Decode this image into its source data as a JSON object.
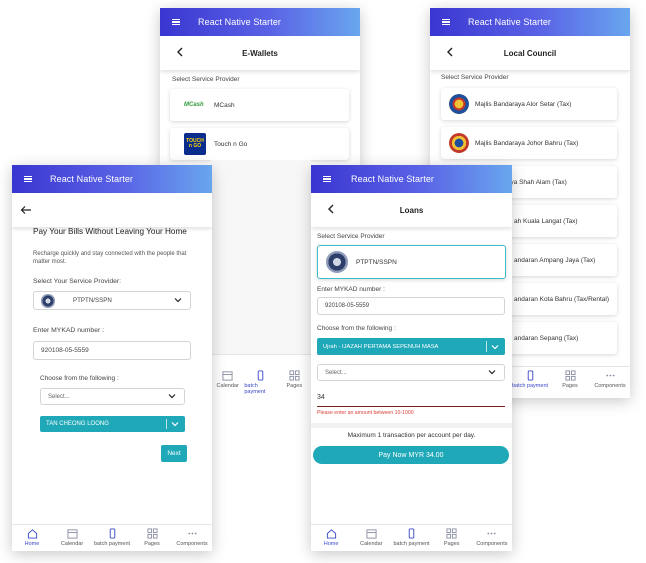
{
  "app": {
    "title": "React Native Starter"
  },
  "nav": [
    {
      "label": "Home",
      "icon": "home-icon"
    },
    {
      "label": "Calendar",
      "icon": "calendar-icon"
    },
    {
      "label": "batch payment",
      "icon": "phone-icon"
    },
    {
      "label": "Pages",
      "icon": "grid-icon"
    },
    {
      "label": "Components",
      "icon": "more-icon"
    }
  ],
  "ewallets": {
    "title": "E-Wallets",
    "section_label": "Select Service Provider",
    "providers": [
      {
        "name": "MCash",
        "logo_text": "MCash"
      },
      {
        "name": "Touch n Go",
        "logo_text": "TOUCH n GO"
      }
    ]
  },
  "local_council": {
    "title": "Local Council",
    "section_label": "Select Service Provider",
    "providers": [
      "Majlis Bandaraya Alor Setar (Tax)",
      "Majlis Bandaraya Johor Bahru (Tax)",
      "araya Shah Alam (Tax)",
      "ah Kuala Langat (Tax)",
      "andaran Ampang Jaya (Tax)",
      "andaran Kota Bahru (Tax/Rental)",
      "andaran Sepang (Tax)"
    ],
    "nav_visible": [
      "batch payment",
      "Pages",
      "Components"
    ]
  },
  "home": {
    "headline": "Pay Your Bills Without Leaving Your Home",
    "subtext": "Recharge quickly and stay connected with the people that matter most.",
    "provider_label": "Select Your Service Provider:",
    "provider_value": "PTPTN/SSPN",
    "mykad_label": "Enter MYKAD number :",
    "mykad_value": "920108-05-5559",
    "choose_label": "Choose from the following :",
    "select_placeholder": "Select...",
    "selected_option": "TAN CHEONG LOONG",
    "next_label": "Next"
  },
  "loans": {
    "title": "Loans",
    "section_label": "Select Service Provider",
    "provider_value": "PTPTN/SSPN",
    "mykad_label": "Enter MYKAD number :",
    "mykad_value": "920108-05-5559",
    "choose_label": "Choose from the following :",
    "selected_option": "Ujrah - IJAZAH PERTAMA SEPENUH MASA",
    "select_placeholder": "Select...",
    "amount_value": "34",
    "error_text": "Please enter an amount between 10-1000",
    "max_note": "Maximum 1 transaction per account per day.",
    "pay_label": "Pay Now MYR 34.00"
  },
  "colors": {
    "accent": "#1fa8b8",
    "brand_start": "#3a36d1",
    "brand_end": "#69a6ee",
    "error": "#d9423b"
  }
}
